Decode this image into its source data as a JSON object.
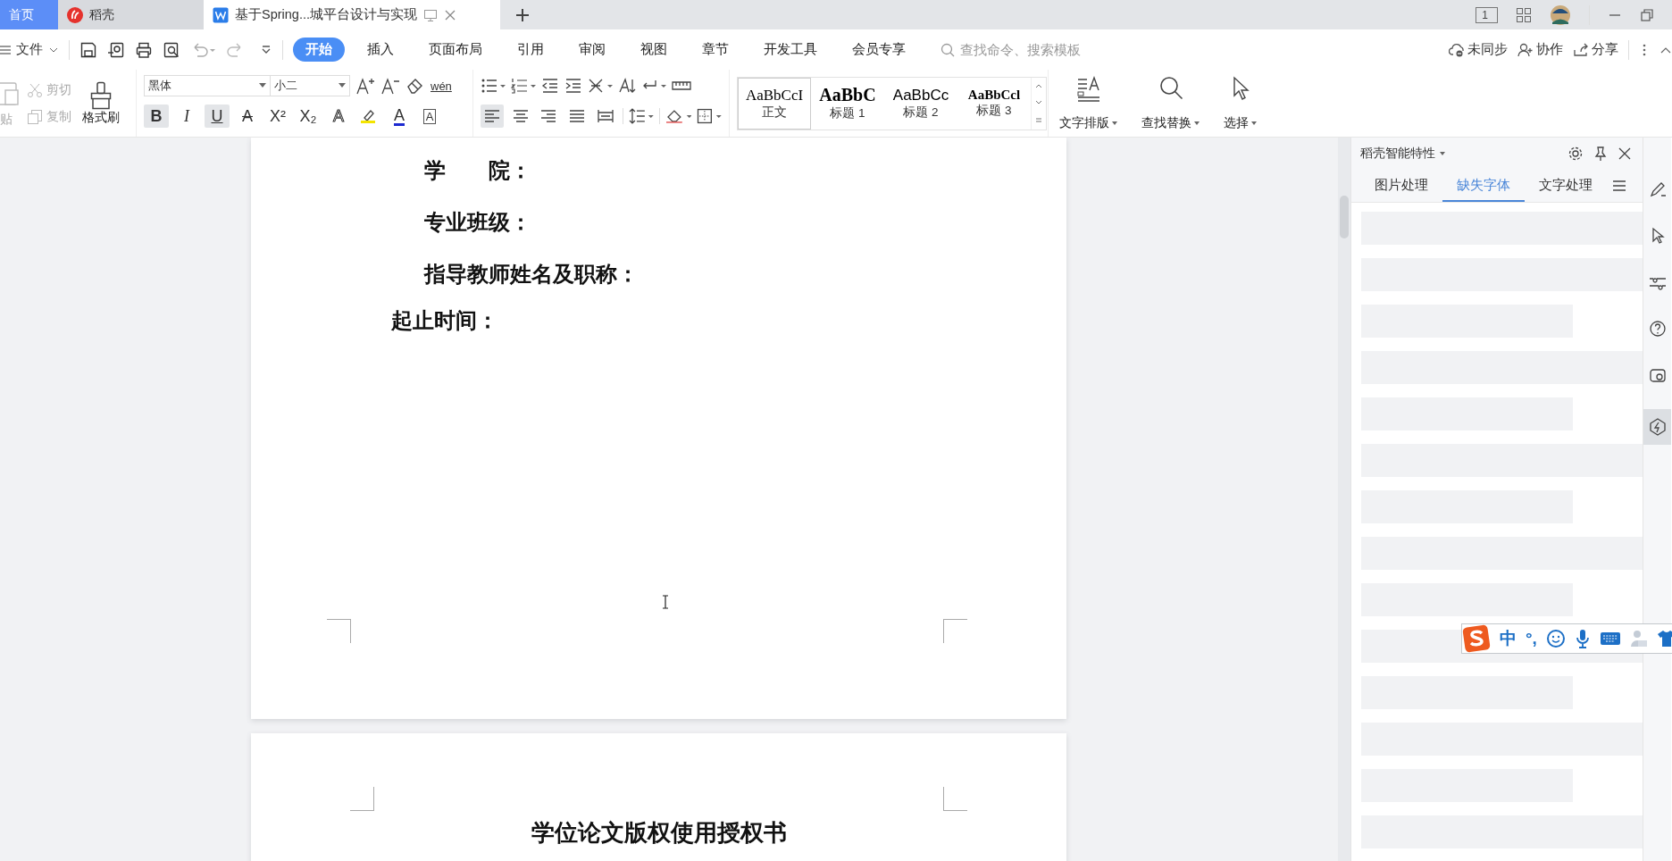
{
  "tabs": [
    {
      "label": "首页",
      "kind": "home",
      "selected": false
    },
    {
      "label": "稻壳",
      "kind": "docer",
      "selected": false
    },
    {
      "label": "基于Spring...城平台设计与实现",
      "kind": "doc",
      "selected": true
    }
  ],
  "title_bar": {
    "page_badge": "1"
  },
  "menu": {
    "file": "文件",
    "items": [
      {
        "label": "开始",
        "selected": true
      },
      {
        "label": "插入",
        "selected": false
      },
      {
        "label": "页面布局",
        "selected": false
      },
      {
        "label": "引用",
        "selected": false
      },
      {
        "label": "审阅",
        "selected": false
      },
      {
        "label": "视图",
        "selected": false
      },
      {
        "label": "章节",
        "selected": false
      },
      {
        "label": "开发工具",
        "selected": false
      },
      {
        "label": "会员专享",
        "selected": false
      }
    ],
    "search_placeholder": "查找命令、搜索模板",
    "actions": [
      {
        "label": "未同步",
        "kind": "cloud"
      },
      {
        "label": "协作",
        "kind": "collab"
      },
      {
        "label": "分享",
        "kind": "share"
      }
    ]
  },
  "ribbon": {
    "paste": "贴",
    "cut": "剪切",
    "copy": "复制",
    "format_painter": "格式刷",
    "font": "黑体",
    "size": "小二",
    "pinyin": "wén",
    "format": [
      {
        "label": "B",
        "kind": "bold",
        "selected": true
      },
      {
        "label": "I",
        "kind": "italic",
        "selected": false
      },
      {
        "label": "U",
        "kind": "underline",
        "selected": true
      },
      {
        "label": "A",
        "kind": "strike",
        "selected": false
      },
      {
        "label": "X²",
        "kind": "plain",
        "selected": false
      },
      {
        "label": "X₂",
        "kind": "plain",
        "selected": false
      },
      {
        "label": "A",
        "kind": "outline",
        "selected": false
      },
      {
        "kind": "highlight",
        "selected": false
      },
      {
        "label": "A",
        "kind": "color",
        "selected": false
      },
      {
        "label": "A",
        "kind": "boxed",
        "selected": false
      }
    ],
    "align": [
      {
        "kind": "left",
        "selected": true
      },
      {
        "kind": "center",
        "selected": false
      },
      {
        "kind": "right",
        "selected": false
      },
      {
        "kind": "justify",
        "selected": false
      },
      {
        "kind": "distributed",
        "selected": false
      }
    ],
    "styles": [
      {
        "sample": "AaBbCcI",
        "name": "正文",
        "kind": "normal",
        "selected": true
      },
      {
        "sample": "AaBbC",
        "name": "标题 1",
        "kind": "h1",
        "selected": false
      },
      {
        "sample": "AaBbCc",
        "name": "标题 2",
        "kind": "h2",
        "selected": false
      },
      {
        "sample": "AaBbCcl",
        "name": "标题 3",
        "kind": "h3",
        "selected": false
      }
    ],
    "big_buttons": [
      {
        "label": "文字排版",
        "kind": "layout"
      },
      {
        "label": "查找替换",
        "kind": "find"
      },
      {
        "label": "选择",
        "kind": "select"
      }
    ]
  },
  "document": {
    "lines": [
      {
        "text": "学　　院：",
        "kind": "indented"
      },
      {
        "text": "专业班级：",
        "kind": "indented"
      },
      {
        "text": "指导教师姓名及职称：",
        "kind": "indented"
      },
      {
        "text": "起止时间：",
        "kind": "flush"
      }
    ],
    "next_page_title": "学位论文版权使用授权书"
  },
  "side_panel": {
    "title": "稻壳智能特性",
    "tabs": [
      {
        "label": "图片处理",
        "selected": false
      },
      {
        "label": "缺失字体",
        "selected": true
      },
      {
        "label": "文字处理",
        "selected": false
      }
    ],
    "placeholders": [
      {
        "kind": "long"
      },
      {
        "kind": "long"
      },
      {
        "kind": "short"
      },
      {
        "kind": "long"
      },
      {
        "kind": "short"
      },
      {
        "kind": "long"
      },
      {
        "kind": "short"
      },
      {
        "kind": "long"
      },
      {
        "kind": "short"
      },
      {
        "kind": "long"
      },
      {
        "kind": "short"
      },
      {
        "kind": "long"
      },
      {
        "kind": "short"
      },
      {
        "kind": "long"
      }
    ]
  },
  "side_tools": [
    {
      "kind": "pen",
      "selected": false
    },
    {
      "kind": "cursor",
      "selected": false
    },
    {
      "kind": "sliders",
      "selected": false
    },
    {
      "kind": "help",
      "selected": false
    },
    {
      "kind": "store",
      "selected": false
    },
    {
      "kind": "bolt",
      "selected": true
    }
  ],
  "ime": {
    "mode": "中",
    "punct": "°,"
  }
}
